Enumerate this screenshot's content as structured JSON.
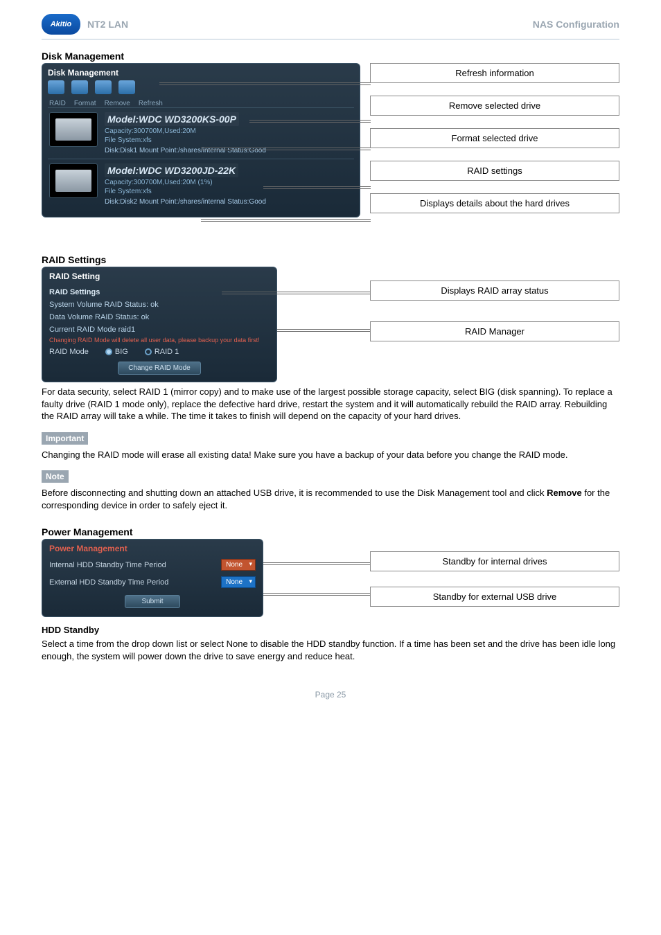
{
  "header": {
    "logo_text": "Akitio",
    "left_title": "NT2 LAN",
    "right_title": "NAS Configuration"
  },
  "disk_management": {
    "section_title": "Disk Management",
    "panel_title": "Disk Management",
    "toolbar": {
      "raid": "RAID",
      "format": "Format",
      "remove": "Remove",
      "refresh": "Refresh"
    },
    "drive1": {
      "model": "Model:WDC WD3200KS-00P",
      "capacity": "Capacity:300700M,Used:20M",
      "fs": "File System:xfs",
      "status": "Disk:Disk1   Mount Point:/shares/internal   Status:Good"
    },
    "drive2": {
      "model": "Model:WDC WD3200JD-22K",
      "capacity": "Capacity:300700M,Used:20M (1%)",
      "fs": "File System:xfs",
      "status": "Disk:Disk2   Mount Point:/shares/internal   Status:Good"
    },
    "callouts": {
      "refresh": "Refresh information",
      "remove": "Remove selected drive",
      "format": "Format selected drive",
      "raid": "RAID settings",
      "details": "Displays details about the hard drives"
    }
  },
  "raid": {
    "section_title": "RAID Settings",
    "panel_title": "RAID Setting",
    "group_label": "RAID Settings",
    "sys_status": "System Volume RAID Status:    ok",
    "data_status": "Data Volume RAID Status:    ok",
    "current_mode": "Current RAID Mode     raid1",
    "warn": "Changing RAID Mode will delete all user data, please backup your data first!",
    "mode_label": "RAID Mode",
    "opt_big": "BIG",
    "opt_raid1": "RAID 1",
    "change_btn": "Change RAID Mode",
    "callouts": {
      "status": "Displays RAID array status",
      "manager": "RAID Manager"
    },
    "paragraph": "For data security, select RAID 1 (mirror copy) and to make use of the largest possible storage capacity, select BIG (disk spanning). To replace a faulty drive (RAID 1 mode only), replace the defective hard drive, restart the system and it will automatically rebuild the RAID array. Rebuilding the RAID array will take a while. The time it takes to finish will depend on the capacity of your hard drives."
  },
  "important": {
    "label": "Important",
    "text": "Changing the RAID mode will erase all existing data! Make sure you have a backup of your data before you change the RAID mode."
  },
  "note": {
    "label": "Note",
    "text_pre": "Before disconnecting and shutting down an attached USB drive, it is recommended to use the Disk Management tool and click ",
    "bold": "Remove",
    "text_post": " for the corresponding device in order to safely eject it."
  },
  "power": {
    "section_title": "Power Management",
    "panel_title": "Power Management",
    "internal_label": "Internal HDD Standby Time Period",
    "external_label": "External HDD Standby Time Period",
    "select_none": "None",
    "submit": "Submit",
    "callouts": {
      "internal": "Standby for internal drives",
      "external": "Standby for external USB drive"
    }
  },
  "hdd_standby": {
    "title": "HDD Standby",
    "text": "Select a time from the drop down list or select None to disable the HDD standby function. If a time has been set and the drive has been idle long enough, the system will power down the drive to save energy and reduce heat."
  },
  "footer": {
    "page": "Page 25"
  }
}
